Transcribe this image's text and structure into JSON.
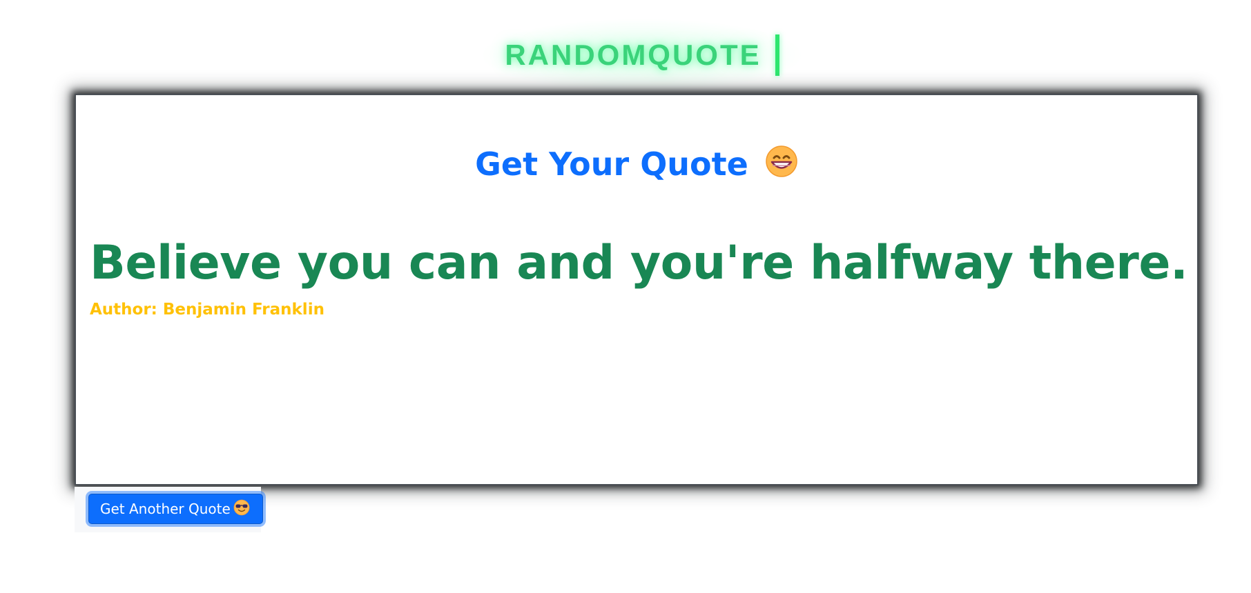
{
  "header": {
    "brand": "RANDOMQUOTE"
  },
  "card": {
    "heading": "Get Your Quote",
    "heading_icon": "grinning-face-icon",
    "quote": "Believe you can and you're halfway there.",
    "author": "Author: Benjamin Franklin"
  },
  "actions": {
    "new_quote_label": "Get Another Quote",
    "new_quote_icon": "cool-face-icon"
  },
  "colors": {
    "brand": "#3ad37a",
    "heading": "#0d6efd",
    "quote": "#198754",
    "author": "#ffc107",
    "button": "#0d6efd"
  }
}
